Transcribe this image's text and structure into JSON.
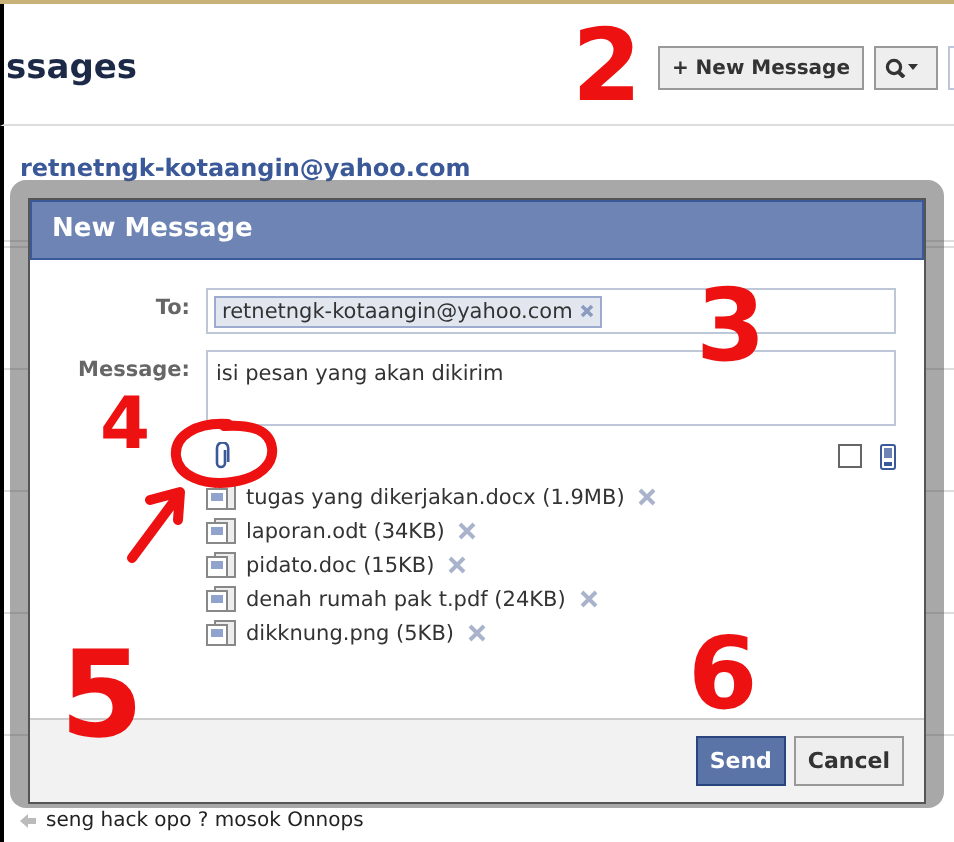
{
  "header": {
    "title": "ssages",
    "new_message_button": "+ New Message"
  },
  "conversations": [
    {
      "name": "retnetngk-kotaangin@yahoo.com"
    },
    {
      "snippet": "seng hack opo ? mosok Onnops"
    }
  ],
  "dialog": {
    "title": "New Message",
    "to_label": "To:",
    "recipients": [
      {
        "label": "retnetngk-kotaangin@yahoo.com"
      }
    ],
    "message_label": "Message:",
    "message": "isi pesan yang akan dikirim",
    "sms_checkbox": {
      "checked": false
    },
    "attachments": [
      {
        "name": "tugas yang dikerjakan.docx (1.9MB)"
      },
      {
        "name": "laporan.odt (34KB)"
      },
      {
        "name": "pidato.doc (15KB)"
      },
      {
        "name": "denah rumah pak t.pdf (24KB)"
      },
      {
        "name": "dikknung.png (5KB)"
      }
    ],
    "buttons": [
      {
        "label": "Send",
        "kind": "primary"
      },
      {
        "label": "Cancel",
        "kind": "secondary"
      }
    ]
  },
  "annotations": [
    {
      "text": "2"
    },
    {
      "text": "3"
    },
    {
      "text": "4"
    },
    {
      "text": "5"
    },
    {
      "text": "6"
    }
  ]
}
